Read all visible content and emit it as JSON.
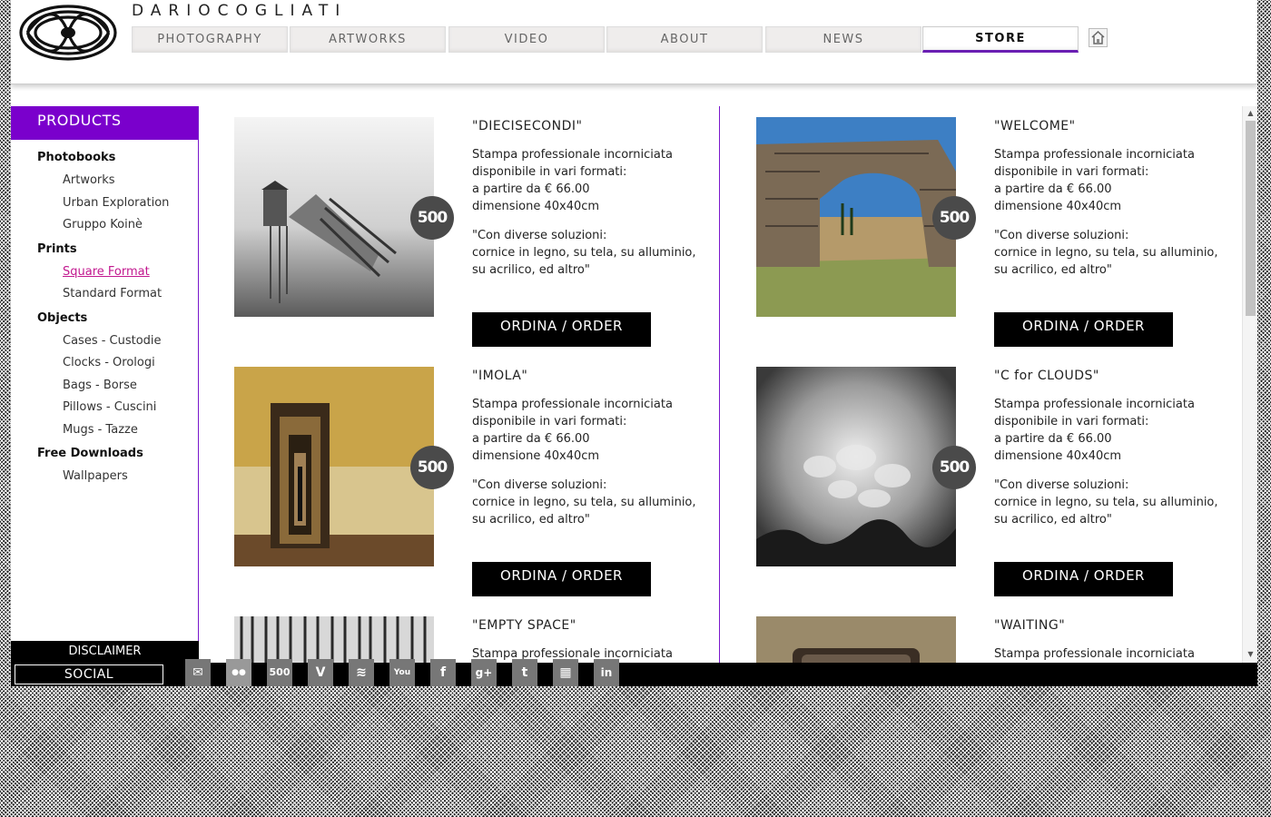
{
  "site": {
    "name": "DARIOCOGLIATI"
  },
  "nav": {
    "tabs": [
      {
        "label": "PHOTOGRAPHY"
      },
      {
        "label": "ARTWORKS"
      },
      {
        "label": "VIDEO"
      },
      {
        "label": "ABOUT"
      },
      {
        "label": "NEWS"
      },
      {
        "label": "STORE",
        "active": true
      }
    ],
    "home_icon": "home-icon"
  },
  "sidebar": {
    "title": "PRODUCTS",
    "sections": [
      {
        "label": "Photobooks",
        "items": [
          "Artworks",
          "Urban Exploration",
          "Gruppo Koinè"
        ]
      },
      {
        "label": "Prints",
        "items": [
          "Square Format",
          "Standard Format"
        ],
        "active_item": "Square Format"
      },
      {
        "label": "Objects",
        "items": [
          "Cases - Custodie",
          "Clocks - Orologi",
          "Bags - Borse",
          "Pillows - Cuscini",
          "Mugs - Tazze"
        ]
      },
      {
        "label": "Free Downloads",
        "items": [
          "Wallpapers"
        ]
      }
    ],
    "disclaimer": "DISCLAIMER"
  },
  "badge_label": "500",
  "products": [
    {
      "title": "\"DIECISECONDI\"",
      "desc1": "Stampa professionale incorniciata",
      "desc2": "disponibile in vari formati:",
      "desc3": "a partire da € 66.00",
      "desc4": "dimensione 40x40cm",
      "note1": "\"Con diverse soluzioni:",
      "note2": "cornice in legno, su tela, su alluminio,",
      "note3": "su acrilico, ed altro\"",
      "button": "ORDINA / ORDER"
    },
    {
      "title": "\"WELCOME\"",
      "desc1": "Stampa professionale incorniciata",
      "desc2": "disponibile in vari formati:",
      "desc3": "a partire da € 66.00",
      "desc4": "dimensione 40x40cm",
      "note1": "\"Con diverse soluzioni:",
      "note2": "cornice in legno, su tela, su alluminio,",
      "note3": "su acrilico, ed altro\"",
      "button": "ORDINA / ORDER"
    },
    {
      "title": "\"IMOLA\"",
      "desc1": "Stampa professionale incorniciata",
      "desc2": "disponibile in vari formati:",
      "desc3": "a partire da € 66.00",
      "desc4": "dimensione 40x40cm",
      "note1": "\"Con diverse soluzioni:",
      "note2": "cornice in legno, su tela, su alluminio,",
      "note3": "su acrilico, ed altro\"",
      "button": "ORDINA / ORDER"
    },
    {
      "title": "\"C for CLOUDS\"",
      "desc1": "Stampa professionale incorniciata",
      "desc2": "disponibile in vari formati:",
      "desc3": "a partire da € 66.00",
      "desc4": "dimensione 40x40cm",
      "note1": "\"Con diverse soluzioni:",
      "note2": "cornice in legno, su tela, su alluminio,",
      "note3": "su acrilico, ed altro\"",
      "button": "ORDINA / ORDER"
    },
    {
      "title": "\"EMPTY SPACE\"",
      "desc1": "Stampa professionale incorniciata"
    },
    {
      "title": "\"WAITING\"",
      "desc1": "Stampa professionale incorniciata"
    }
  ],
  "footer": {
    "social_label": "SOCIAL",
    "icons": [
      {
        "name": "mail-icon",
        "glyph": "✉"
      },
      {
        "name": "flickr-icon",
        "glyph": "●●"
      },
      {
        "name": "500px-icon",
        "glyph": "500"
      },
      {
        "name": "vimeo-icon",
        "glyph": "V"
      },
      {
        "name": "behance-icon",
        "glyph": "≋"
      },
      {
        "name": "youtube-icon",
        "glyph": "You"
      },
      {
        "name": "facebook-icon",
        "glyph": "f"
      },
      {
        "name": "google-plus-icon",
        "glyph": "g+"
      },
      {
        "name": "tumblr-icon",
        "glyph": "t"
      },
      {
        "name": "pattern-icon",
        "glyph": "▦"
      },
      {
        "name": "linkedin-icon",
        "glyph": "in"
      }
    ]
  },
  "colors": {
    "accent": "#7a00cc",
    "active_link": "#c2188f",
    "button_bg": "#000000"
  }
}
